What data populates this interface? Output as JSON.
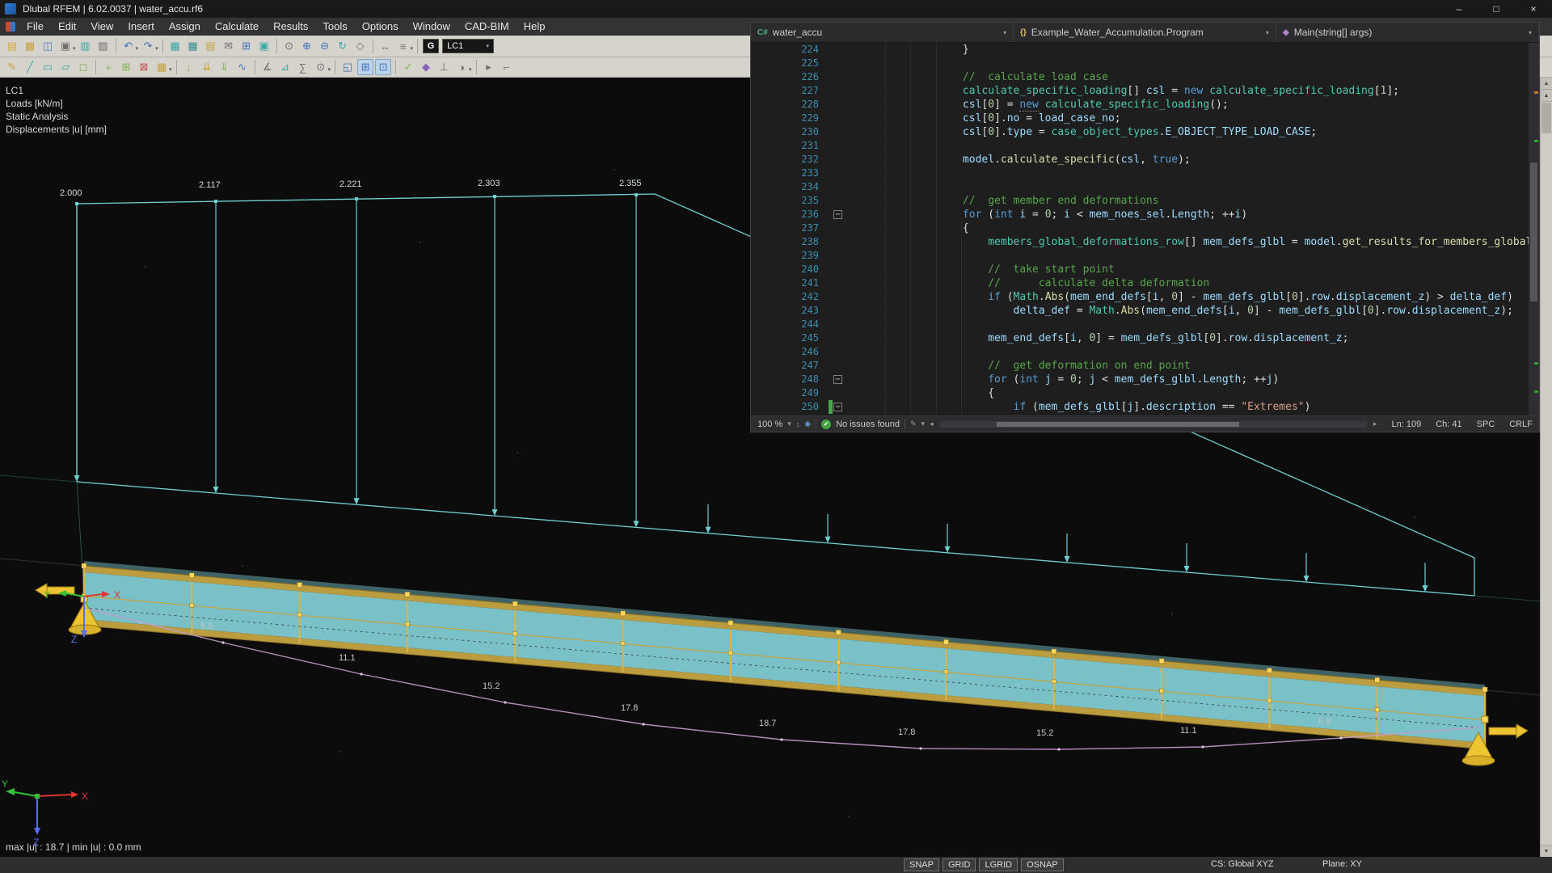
{
  "window": {
    "title": "Dlubal RFEM | 6.02.0037 | water_accu.rf6",
    "controls": {
      "minimize": "–",
      "maximize": "□",
      "close": "×"
    }
  },
  "menu": {
    "items": [
      "File",
      "Edit",
      "View",
      "Insert",
      "Assign",
      "Calculate",
      "Results",
      "Tools",
      "Options",
      "Window",
      "CAD-BIM",
      "Help"
    ]
  },
  "toolbar1": [
    {
      "name": "new-model-icon",
      "glyph": "▤",
      "color": "#d8a93c"
    },
    {
      "name": "open-file-icon",
      "glyph": "▦",
      "color": "#c9a23f"
    },
    {
      "name": "save-icon",
      "glyph": "◫",
      "color": "#4a7fc1"
    },
    {
      "name": "print-icon",
      "glyph": "▣",
      "color": "#6f6f6f",
      "caret": true
    },
    {
      "name": "screenshot-icon",
      "glyph": "▥",
      "color": "#3aa6a6"
    },
    {
      "name": "copy-icon",
      "glyph": "▨",
      "color": "#6f6f6f"
    },
    {
      "sep": true
    },
    {
      "name": "undo-icon",
      "glyph": "↶",
      "color": "#3f74b8",
      "caret": true
    },
    {
      "name": "redo-icon",
      "glyph": "↷",
      "color": "#3f74b8",
      "caret": true
    },
    {
      "sep": true
    },
    {
      "name": "data-table-icon",
      "glyph": "▦",
      "color": "#3aa6a6"
    },
    {
      "name": "results-table-icon",
      "glyph": "▦",
      "color": "#2f8f8f"
    },
    {
      "name": "printout-report-icon",
      "glyph": "▤",
      "color": "#c9a23f"
    },
    {
      "name": "mail-icon",
      "glyph": "✉",
      "color": "#6f6f6f"
    },
    {
      "name": "grid-icon",
      "glyph": "⊞",
      "color": "#3f74b8"
    },
    {
      "name": "panel-icon",
      "glyph": "▣",
      "color": "#3aa6a6"
    },
    {
      "sep": true
    },
    {
      "name": "zoom-window-icon",
      "glyph": "⊙",
      "color": "#6f6f6f"
    },
    {
      "name": "zoom-in-icon",
      "glyph": "⊕",
      "color": "#3f74b8"
    },
    {
      "name": "zoom-out-icon",
      "glyph": "⊖",
      "color": "#3f74b8"
    },
    {
      "name": "rotate-view-icon",
      "glyph": "↻",
      "color": "#3aa6a6"
    },
    {
      "name": "isometric-view-icon",
      "glyph": "◇",
      "color": "#6f6f6f"
    },
    {
      "sep": true
    },
    {
      "name": "move-view-icon",
      "glyph": "↔",
      "color": "#6f6f6f"
    },
    {
      "name": "views-menu-icon",
      "glyph": "≡",
      "color": "#6f6f6f",
      "caret": true
    },
    {
      "sep": true
    },
    {
      "type": "gbox",
      "name": "visibility-g-button",
      "label": "G"
    },
    {
      "type": "combo",
      "name": "load-case-combo",
      "label": "LC1"
    }
  ],
  "toolbar2": [
    {
      "name": "edit-icon",
      "glyph": "✎",
      "color": "#c9a23f"
    },
    {
      "name": "line-icon",
      "glyph": "╱",
      "color": "#3aa6a6"
    },
    {
      "name": "member-icon",
      "glyph": "▭",
      "color": "#3aa6a6"
    },
    {
      "name": "surface-icon",
      "glyph": "▱",
      "color": "#3aa6a6"
    },
    {
      "name": "solid-icon",
      "glyph": "◻",
      "color": "#7ab648"
    },
    {
      "sep": true
    },
    {
      "name": "node-icon",
      "glyph": "+",
      "color": "#7ab648"
    },
    {
      "name": "mesh-icon",
      "glyph": "⊞",
      "color": "#7ab648"
    },
    {
      "name": "support-icon",
      "glyph": "⊠",
      "color": "#c0504d"
    },
    {
      "name": "hinge-icon",
      "glyph": "▦",
      "color": "#c9a23f",
      "caret": true
    },
    {
      "sep": true
    },
    {
      "name": "nodal-load-icon",
      "glyph": "↓",
      "color": "#c9a23f"
    },
    {
      "name": "line-load-icon",
      "glyph": "⇊",
      "color": "#c9a23f"
    },
    {
      "name": "area-load-icon",
      "glyph": "⇓",
      "color": "#7ab648"
    },
    {
      "name": "imperfection-icon",
      "glyph": "∿",
      "color": "#3f74b8"
    },
    {
      "sep": true
    },
    {
      "name": "dimension-icon",
      "glyph": "∡",
      "color": "#6f6f6f"
    },
    {
      "name": "section-icon",
      "glyph": "⊿",
      "color": "#3aa6a6"
    },
    {
      "name": "sum-icon",
      "glyph": "∑",
      "color": "#6f6f6f"
    },
    {
      "name": "select-tool-icon",
      "glyph": "⊙",
      "color": "#6f6f6f",
      "caret": true
    },
    {
      "sep": true
    },
    {
      "name": "snap-settings-icon",
      "glyph": "◱",
      "color": "#3f74b8"
    },
    {
      "name": "grid-toggle-icon",
      "glyph": "⊞",
      "color": "#3f74b8",
      "pressed": true
    },
    {
      "name": "work-plane-icon",
      "glyph": "⊡",
      "color": "#3f74b8",
      "pressed": true
    },
    {
      "sep": true
    },
    {
      "name": "check-model-icon",
      "glyph": "✓",
      "color": "#7ab648"
    },
    {
      "name": "render-mode-icon",
      "glyph": "◆",
      "color": "#8a63b8"
    },
    {
      "name": "axes-display-icon",
      "glyph": "⊥",
      "color": "#6f6f6f"
    },
    {
      "name": "visibility-mode-icon",
      "glyph": "◑",
      "color": "#6f6f6f",
      "caret": true
    },
    {
      "sep": true
    },
    {
      "name": "pointer-icon",
      "glyph": "▸",
      "color": "#6f6f6f"
    },
    {
      "name": "measure-icon",
      "glyph": "⌐",
      "color": "#6f6f6f"
    }
  ],
  "viewport": {
    "info": [
      "LC1",
      "Loads [kN/m]",
      "Static Analysis",
      "Displacements |u| [mm]"
    ],
    "load_values": [
      "2.000",
      "2.117",
      "2.221",
      "2.303",
      "2.355"
    ],
    "deformation_values": [
      "5.9",
      "11.1",
      "15.2",
      "17.8",
      "18.7",
      "17.8",
      "15.2",
      "11.1",
      "5.9"
    ],
    "axis_labels": {
      "x": "X",
      "y": "Y",
      "z": "Z"
    },
    "max_min": "max |u| : 18.7 | min |u| : 0.0 mm"
  },
  "editor": {
    "crumbs": [
      {
        "icon_text": "C#",
        "icon_color": "#4ab581",
        "label": "water_accu"
      },
      {
        "icon_text": "{}",
        "icon_color": "#e0c46c",
        "label": "Example_Water_Accumulation.Program"
      },
      {
        "icon_text": "◆",
        "icon_color": "#b180d7",
        "label": "Main(string[] args)"
      }
    ],
    "status": {
      "zoom": "100 %",
      "issues": "No issues found",
      "ln": "Ln: 109",
      "ch": "Ch: 41",
      "enc": "SPC",
      "eol": "CRLF"
    },
    "lines": [
      {
        "no": "224",
        "segs": [
          [
            "p",
            "            }"
          ]
        ]
      },
      {
        "no": "225",
        "segs": []
      },
      {
        "no": "226",
        "segs": [
          [
            "p",
            "            "
          ],
          [
            "c",
            "//  calculate load case"
          ]
        ]
      },
      {
        "no": "227",
        "segs": [
          [
            "p",
            "            "
          ],
          [
            "t",
            "calculate_specific_loading"
          ],
          [
            "p",
            "[] "
          ],
          [
            "v",
            "csl"
          ],
          [
            "p",
            " = "
          ],
          [
            "k",
            "new"
          ],
          [
            "p",
            " "
          ],
          [
            "t",
            "calculate_specific_loading"
          ],
          [
            "p",
            "["
          ],
          [
            "n",
            "1"
          ],
          [
            "p",
            "];"
          ]
        ]
      },
      {
        "no": "228",
        "segs": [
          [
            "p",
            "            "
          ],
          [
            "v",
            "csl"
          ],
          [
            "p",
            "["
          ],
          [
            "n",
            "0"
          ],
          [
            "p",
            "] = "
          ],
          [
            "ku",
            "new"
          ],
          [
            "p",
            " "
          ],
          [
            "t",
            "calculate_specific_loading"
          ],
          [
            "p",
            "();"
          ]
        ]
      },
      {
        "no": "229",
        "segs": [
          [
            "p",
            "            "
          ],
          [
            "v",
            "csl"
          ],
          [
            "p",
            "["
          ],
          [
            "n",
            "0"
          ],
          [
            "p",
            "]."
          ],
          [
            "v",
            "no"
          ],
          [
            "p",
            " = "
          ],
          [
            "v",
            "load_case_no"
          ],
          [
            "p",
            ";"
          ]
        ]
      },
      {
        "no": "230",
        "segs": [
          [
            "p",
            "            "
          ],
          [
            "v",
            "csl"
          ],
          [
            "p",
            "["
          ],
          [
            "n",
            "0"
          ],
          [
            "p",
            "]."
          ],
          [
            "v",
            "type"
          ],
          [
            "p",
            " = "
          ],
          [
            "t",
            "case_object_types"
          ],
          [
            "p",
            "."
          ],
          [
            "v",
            "E_OBJECT_TYPE_LOAD_CASE"
          ],
          [
            "p",
            ";"
          ]
        ]
      },
      {
        "no": "231",
        "segs": []
      },
      {
        "no": "232",
        "segs": [
          [
            "p",
            "            "
          ],
          [
            "v",
            "model"
          ],
          [
            "p",
            "."
          ],
          [
            "m",
            "calculate_specific"
          ],
          [
            "p",
            "("
          ],
          [
            "v",
            "csl"
          ],
          [
            "p",
            ", "
          ],
          [
            "k",
            "true"
          ],
          [
            "p",
            ");"
          ]
        ]
      },
      {
        "no": "233",
        "segs": []
      },
      {
        "no": "234",
        "segs": []
      },
      {
        "no": "235",
        "segs": [
          [
            "p",
            "            "
          ],
          [
            "c",
            "//  get member end deformations"
          ]
        ]
      },
      {
        "no": "236",
        "fold": true,
        "segs": [
          [
            "p",
            "            "
          ],
          [
            "k",
            "for"
          ],
          [
            "p",
            " ("
          ],
          [
            "k",
            "int"
          ],
          [
            "p",
            " "
          ],
          [
            "v",
            "i"
          ],
          [
            "p",
            " = "
          ],
          [
            "n",
            "0"
          ],
          [
            "p",
            "; "
          ],
          [
            "v",
            "i"
          ],
          [
            "p",
            " < "
          ],
          [
            "v",
            "mem_noes_sel"
          ],
          [
            "p",
            "."
          ],
          [
            "v",
            "Length"
          ],
          [
            "p",
            "; ++"
          ],
          [
            "v",
            "i"
          ],
          [
            "p",
            ")"
          ]
        ]
      },
      {
        "no": "237",
        "segs": [
          [
            "p",
            "            {"
          ]
        ]
      },
      {
        "no": "238",
        "segs": [
          [
            "p",
            "                "
          ],
          [
            "t",
            "members_global_deformations_row"
          ],
          [
            "p",
            "[] "
          ],
          [
            "v",
            "mem_defs_glbl"
          ],
          [
            "p",
            " = "
          ],
          [
            "v",
            "model"
          ],
          [
            "p",
            "."
          ],
          [
            "m",
            "get_results_for_members_global_de"
          ]
        ]
      },
      {
        "no": "239",
        "segs": []
      },
      {
        "no": "240",
        "segs": [
          [
            "p",
            "                "
          ],
          [
            "c",
            "//  take start point"
          ]
        ]
      },
      {
        "no": "241",
        "segs": [
          [
            "p",
            "                "
          ],
          [
            "c",
            "//      calculate delta deformation"
          ]
        ]
      },
      {
        "no": "242",
        "segs": [
          [
            "p",
            "                "
          ],
          [
            "k",
            "if"
          ],
          [
            "p",
            " ("
          ],
          [
            "t",
            "Math"
          ],
          [
            "p",
            "."
          ],
          [
            "m",
            "Abs"
          ],
          [
            "p",
            "("
          ],
          [
            "v",
            "mem_end_defs"
          ],
          [
            "p",
            "["
          ],
          [
            "v",
            "i"
          ],
          [
            "p",
            ", "
          ],
          [
            "n",
            "0"
          ],
          [
            "p",
            "] - "
          ],
          [
            "v",
            "mem_defs_glbl"
          ],
          [
            "p",
            "["
          ],
          [
            "n",
            "0"
          ],
          [
            "p",
            "]."
          ],
          [
            "v",
            "row"
          ],
          [
            "p",
            "."
          ],
          [
            "v",
            "displacement_z"
          ],
          [
            "p",
            ") > "
          ],
          [
            "v",
            "delta_def"
          ],
          [
            "p",
            ")"
          ]
        ]
      },
      {
        "no": "243",
        "segs": [
          [
            "p",
            "                    "
          ],
          [
            "v",
            "delta_def"
          ],
          [
            "p",
            " = "
          ],
          [
            "t",
            "Math"
          ],
          [
            "p",
            "."
          ],
          [
            "m",
            "Abs"
          ],
          [
            "p",
            "("
          ],
          [
            "v",
            "mem_end_defs"
          ],
          [
            "p",
            "["
          ],
          [
            "v",
            "i"
          ],
          [
            "p",
            ", "
          ],
          [
            "n",
            "0"
          ],
          [
            "p",
            "] - "
          ],
          [
            "v",
            "mem_defs_glbl"
          ],
          [
            "p",
            "["
          ],
          [
            "n",
            "0"
          ],
          [
            "p",
            "]."
          ],
          [
            "v",
            "row"
          ],
          [
            "p",
            "."
          ],
          [
            "v",
            "displacement_z"
          ],
          [
            "p",
            ");"
          ]
        ]
      },
      {
        "no": "244",
        "segs": []
      },
      {
        "no": "245",
        "segs": [
          [
            "p",
            "                "
          ],
          [
            "v",
            "mem_end_defs"
          ],
          [
            "p",
            "["
          ],
          [
            "v",
            "i"
          ],
          [
            "p",
            ", "
          ],
          [
            "n",
            "0"
          ],
          [
            "p",
            "] = "
          ],
          [
            "v",
            "mem_defs_glbl"
          ],
          [
            "p",
            "["
          ],
          [
            "n",
            "0"
          ],
          [
            "p",
            "]."
          ],
          [
            "v",
            "row"
          ],
          [
            "p",
            "."
          ],
          [
            "v",
            "displacement_z"
          ],
          [
            "p",
            ";"
          ]
        ]
      },
      {
        "no": "246",
        "segs": []
      },
      {
        "no": "247",
        "segs": [
          [
            "p",
            "                "
          ],
          [
            "c",
            "//  get deformation on end point"
          ]
        ]
      },
      {
        "no": "248",
        "fold": true,
        "segs": [
          [
            "p",
            "                "
          ],
          [
            "k",
            "for"
          ],
          [
            "p",
            " ("
          ],
          [
            "k",
            "int"
          ],
          [
            "p",
            " "
          ],
          [
            "v",
            "j"
          ],
          [
            "p",
            " = "
          ],
          [
            "n",
            "0"
          ],
          [
            "p",
            "; "
          ],
          [
            "v",
            "j"
          ],
          [
            "p",
            " < "
          ],
          [
            "v",
            "mem_defs_glbl"
          ],
          [
            "p",
            "."
          ],
          [
            "v",
            "Length"
          ],
          [
            "p",
            "; ++"
          ],
          [
            "v",
            "j"
          ],
          [
            "p",
            ")"
          ]
        ]
      },
      {
        "no": "249",
        "segs": [
          [
            "p",
            "                {"
          ]
        ]
      },
      {
        "no": "250",
        "fold": true,
        "green": true,
        "segs": [
          [
            "p",
            "                    "
          ],
          [
            "k",
            "if"
          ],
          [
            "p",
            " ("
          ],
          [
            "v",
            "mem_defs_glbl"
          ],
          [
            "p",
            "["
          ],
          [
            "v",
            "j"
          ],
          [
            "p",
            "]."
          ],
          [
            "v",
            "description"
          ],
          [
            "p",
            " == "
          ],
          [
            "s",
            "\"Extremes\""
          ],
          [
            "p",
            ")"
          ]
        ]
      }
    ]
  },
  "statusbar": {
    "toggles": [
      "SNAP",
      "GRID",
      "LGRID",
      "OSNAP"
    ],
    "cs": "CS: Global XYZ",
    "plane": "Plane: XY"
  },
  "icons": {
    "caret": "▾",
    "check": "✔",
    "pencil": "✎",
    "left": "◂",
    "right": "▸",
    "up": "▲",
    "down": "▼",
    "updown": "↕",
    "circle": "◉"
  }
}
